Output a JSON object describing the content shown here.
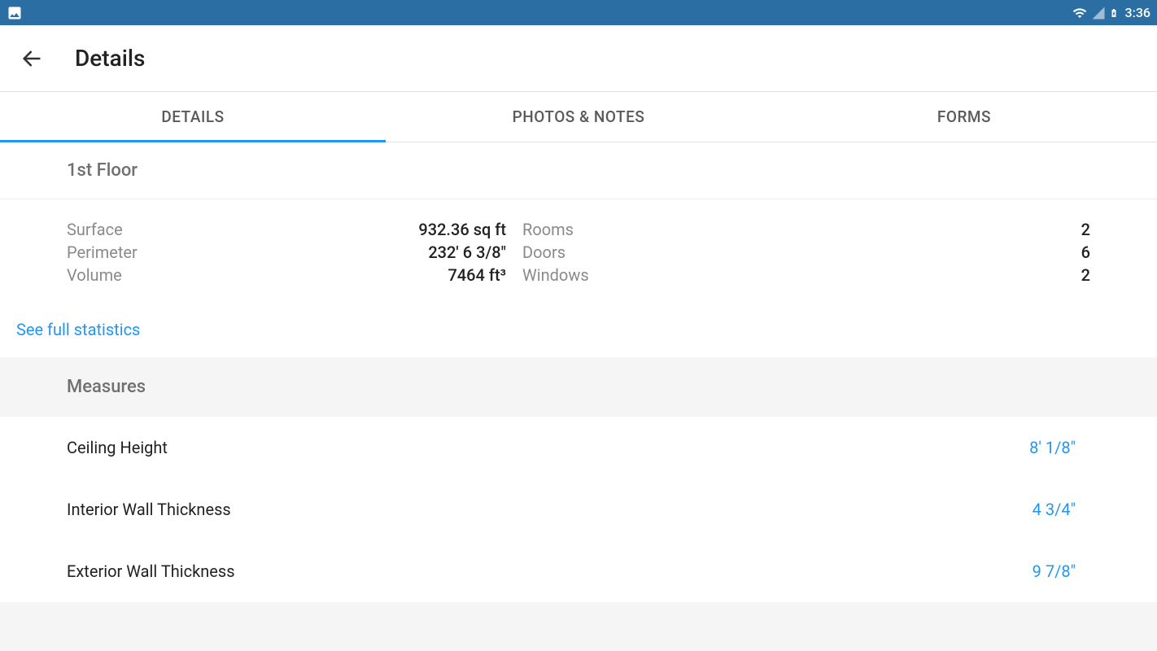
{
  "status": {
    "time": "3:36"
  },
  "header": {
    "title": "Details"
  },
  "tabs": [
    {
      "label": "DETAILS",
      "active": true
    },
    {
      "label": "PHOTOS & NOTES",
      "active": false
    },
    {
      "label": "FORMS",
      "active": false
    }
  ],
  "floor_section": {
    "title": "1st Floor",
    "stats_left": [
      {
        "label": "Surface",
        "value": "932.36 sq ft"
      },
      {
        "label": "Perimeter",
        "value": "232' 6 3/8\""
      },
      {
        "label": "Volume",
        "value": "7464 ft³"
      }
    ],
    "stats_right": [
      {
        "label": "Rooms",
        "value": "2"
      },
      {
        "label": "Doors",
        "value": "6"
      },
      {
        "label": "Windows",
        "value": "2"
      }
    ],
    "link": "See full statistics"
  },
  "measures_section": {
    "title": "Measures",
    "rows": [
      {
        "label": "Ceiling Height",
        "value": "8' 1/8\""
      },
      {
        "label": "Interior Wall Thickness",
        "value": "4 3/4\""
      },
      {
        "label": "Exterior Wall Thickness",
        "value": "9 7/8\""
      }
    ]
  }
}
